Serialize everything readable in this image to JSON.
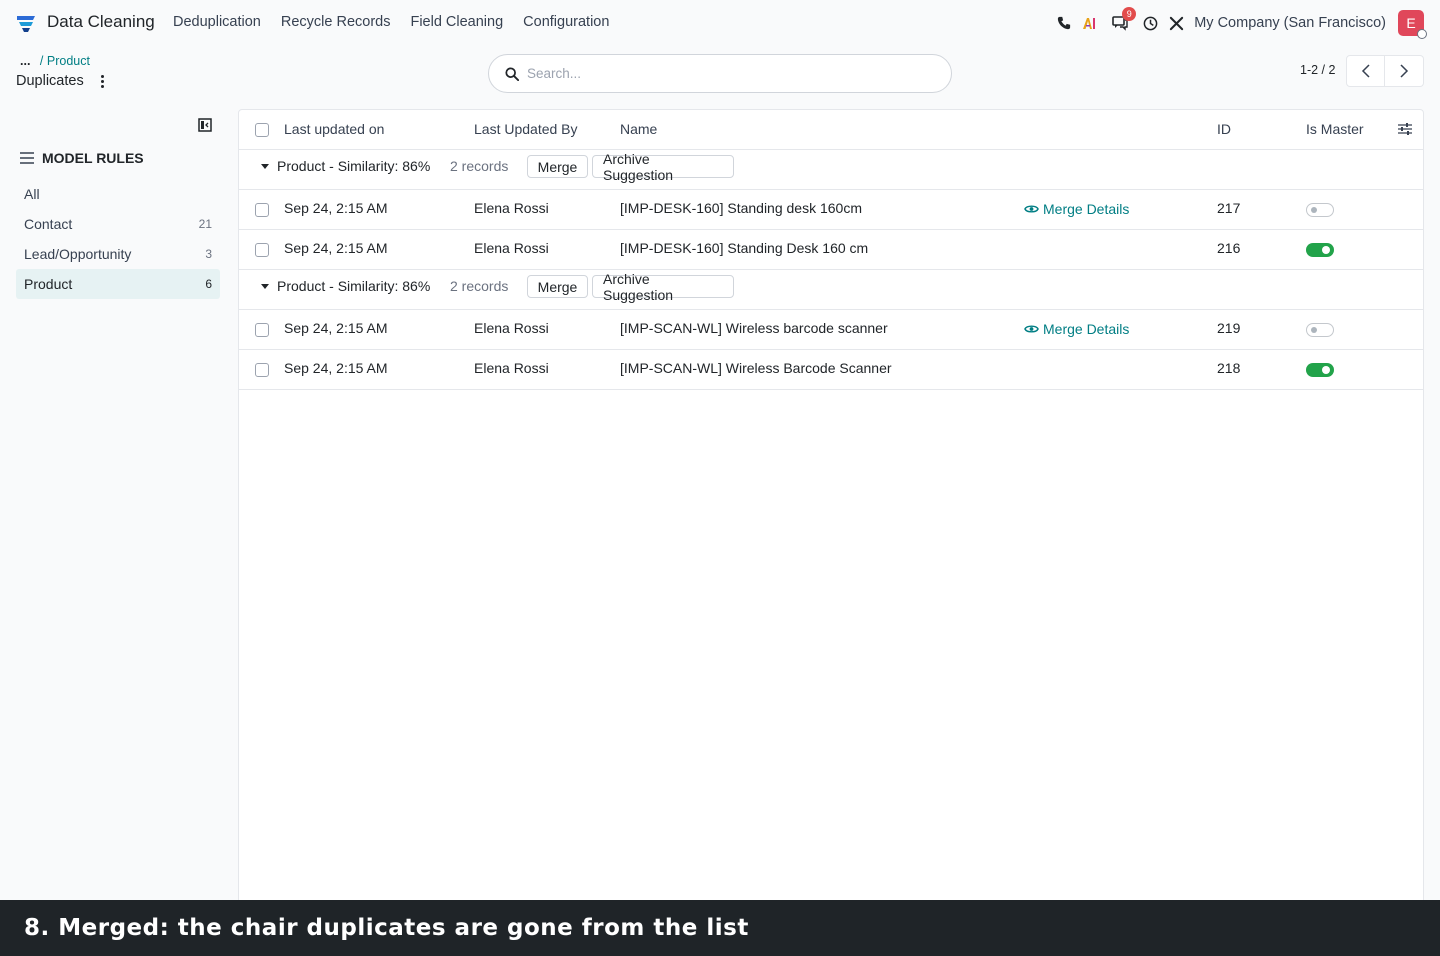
{
  "navbar": {
    "app_name": "Data Cleaning",
    "menu": [
      "Deduplication",
      "Recycle Records",
      "Field Cleaning",
      "Configuration"
    ],
    "messages_badge": "9",
    "company": "My Company (San Francisco)",
    "avatar_initial": "E"
  },
  "breadcrumb": {
    "ellipsis": "...",
    "sep": "/",
    "parent": "Product",
    "title": "Duplicates"
  },
  "search": {
    "placeholder": "Search..."
  },
  "pager": {
    "value": "1-2 / 2"
  },
  "sidebar": {
    "header": "MODEL RULES",
    "items": [
      {
        "label": "All",
        "count": ""
      },
      {
        "label": "Contact",
        "count": "21"
      },
      {
        "label": "Lead/Opportunity",
        "count": "3"
      },
      {
        "label": "Product",
        "count": "6"
      }
    ]
  },
  "list": {
    "columns": [
      "Last updated on",
      "Last Updated By",
      "Name",
      "ID",
      "Is Master"
    ],
    "merge_label": "Merge",
    "archive_label": "Archive Suggestion",
    "merge_details_label": "Merge Details",
    "groups": [
      {
        "name": "Product - Similarity: 86%",
        "count": "2 records",
        "rows": [
          {
            "date": "Sep 24, 2:15 AM",
            "user": "Elena Rossi",
            "name": "[IMP-DESK-160] Standing desk 160cm",
            "id": "217",
            "master": false,
            "details": true
          },
          {
            "date": "Sep 24, 2:15 AM",
            "user": "Elena Rossi",
            "name": "[IMP-DESK-160] Standing Desk 160 cm",
            "id": "216",
            "master": true,
            "details": false
          }
        ]
      },
      {
        "name": "Product - Similarity: 86%",
        "count": "2 records",
        "rows": [
          {
            "date": "Sep 24, 2:15 AM",
            "user": "Elena Rossi",
            "name": "[IMP-SCAN-WL] Wireless barcode scanner",
            "id": "219",
            "master": false,
            "details": true
          },
          {
            "date": "Sep 24, 2:15 AM",
            "user": "Elena Rossi",
            "name": "[IMP-SCAN-WL] Wireless Barcode Scanner",
            "id": "218",
            "master": true,
            "details": false
          }
        ]
      }
    ]
  },
  "caption": "8. Merged: the chair duplicates are gone from the list",
  "colors": {
    "accent": "#017e84",
    "toggle_on": "#22a34a",
    "avatar": "#e0475a"
  }
}
